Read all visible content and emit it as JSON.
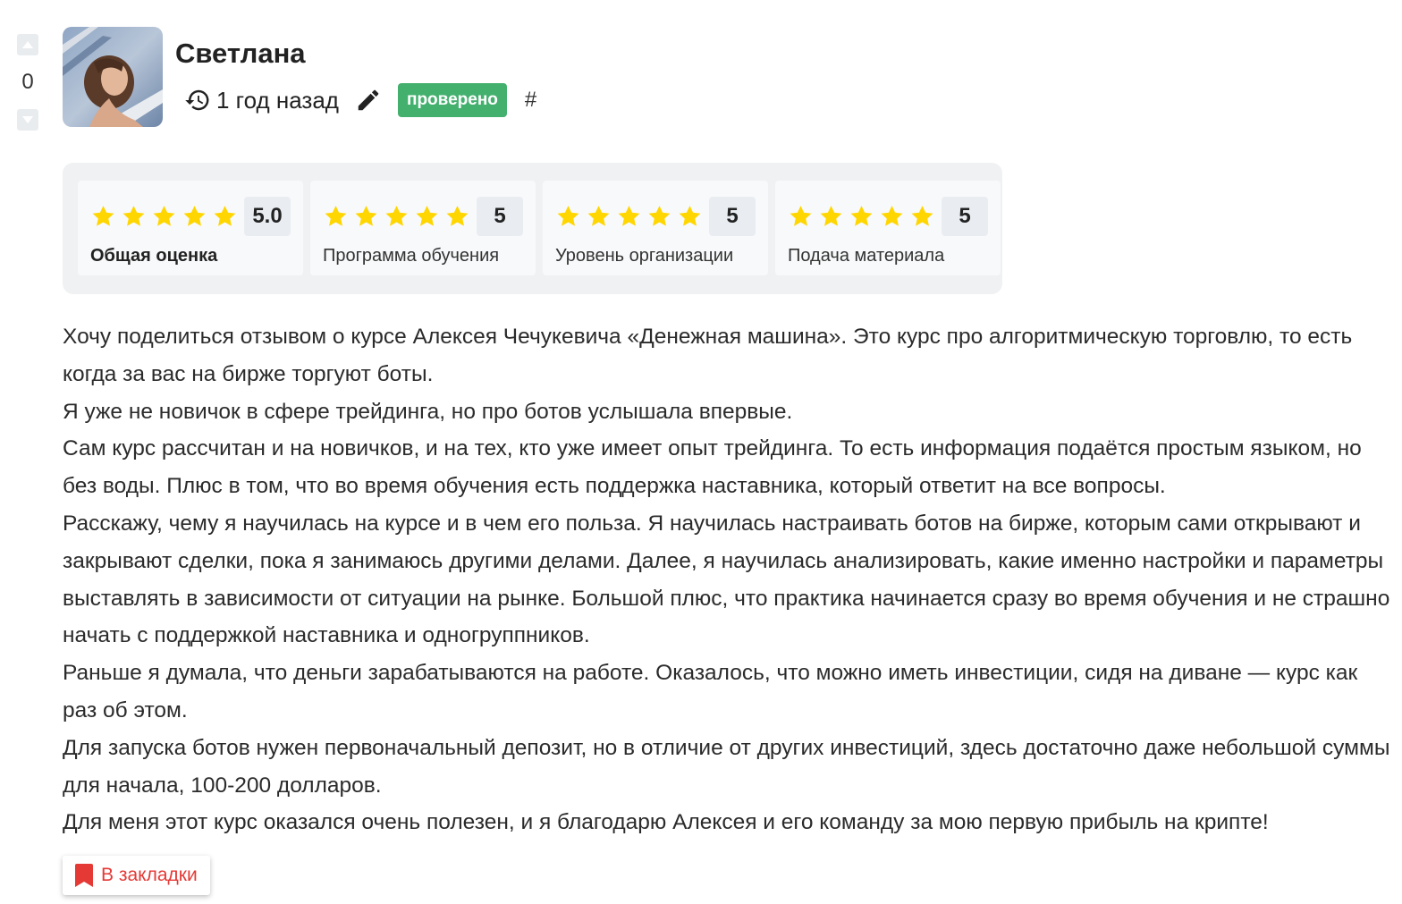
{
  "vote": {
    "count": "0",
    "up_icon": "triangle-up-icon",
    "down_icon": "triangle-down-icon"
  },
  "author": {
    "name": "Светлана",
    "avatar_icon": "avatar-photo"
  },
  "meta": {
    "time_icon": "history-icon",
    "time": "1 год назад",
    "edit_icon": "pencil-icon",
    "badge": "проверено",
    "hash": "#"
  },
  "colors": {
    "badge_bg": "#44b06e",
    "star": "#ffd600",
    "bookmark": "#e53935"
  },
  "ratings": [
    {
      "score": "5.0",
      "stars": 5,
      "label": "Общая оценка",
      "bold": true
    },
    {
      "score": "5",
      "stars": 5,
      "label": "Программа обучения",
      "bold": false
    },
    {
      "score": "5",
      "stars": 5,
      "label": "Уровень организации",
      "bold": false
    },
    {
      "score": "5",
      "stars": 5,
      "label": "Подача материала",
      "bold": false
    }
  ],
  "review": {
    "paragraphs": [
      "Хочу поделиться отзывом о курсе Алексея Чечукевича «Денежная машина». Это курс про алгоритмическую торговлю, то есть когда за вас на бирже торгуют боты.",
      "Я уже не новичок в сфере трейдинга, но про ботов услышала впервые.",
      "Сам курс рассчитан и на новичков, и на тех, кто уже имеет опыт трейдинга. То есть информация подаётся простым языком, но без воды. Плюс в том, что во время обучения есть поддержка наставника, который ответит на все вопросы.",
      "Расскажу, чему я научилась на курсе и в чем его польза. Я научилась настраивать ботов на бирже, которым сами открывают и закрывают сделки, пока я занимаюсь другими делами. Далее, я научилась анализировать, какие именно настройки и параметры выставлять в зависимости от ситуации на рынке. Большой плюс, что практика начинается сразу во время обучения и не страшно начать с поддержкой наставника и одногруппников.",
      "Раньше я думала, что деньги зарабатываются на работе. Оказалось, что можно иметь инвестиции, сидя на диване — курс как раз об этом.",
      "Для запуска ботов нужен первоначальный депозит, но в отличие от других инвестиций, здесь достаточно даже небольшой суммы для начала, 100-200 долларов.",
      "Для меня этот курс оказался очень полезен, и я благодарю Алексея и его команду за мою первую прибыль на крипте!"
    ]
  },
  "bookmark": {
    "icon": "bookmark-icon",
    "label": "В закладки"
  }
}
